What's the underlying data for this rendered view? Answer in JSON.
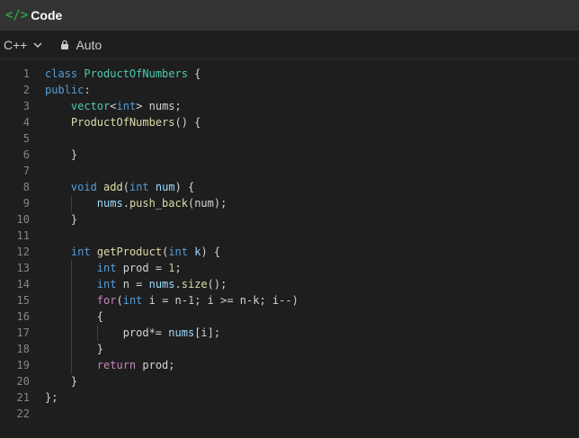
{
  "header": {
    "icon": "code-icon",
    "title": "Code"
  },
  "toolbar": {
    "language": "C++",
    "mode": "Auto"
  },
  "colors": {
    "accent": "#2ea043",
    "background": "#1e1e1e",
    "header": "#333333"
  },
  "editor": {
    "lines": [
      {
        "n": "1",
        "indent": 0,
        "tokens": [
          [
            "kw",
            "class"
          ],
          [
            "pl",
            " "
          ],
          [
            "ty",
            "ProductOfNumbers"
          ],
          [
            "pl",
            " {"
          ]
        ]
      },
      {
        "n": "2",
        "indent": 0,
        "tokens": [
          [
            "kw",
            "public"
          ],
          [
            "pl",
            ":"
          ]
        ]
      },
      {
        "n": "3",
        "indent": 1,
        "tokens": [
          [
            "ty",
            "vector"
          ],
          [
            "pl",
            "<"
          ],
          [
            "kw",
            "int"
          ],
          [
            "pl",
            "> nums;"
          ]
        ]
      },
      {
        "n": "4",
        "indent": 1,
        "tokens": [
          [
            "fn",
            "ProductOfNumbers"
          ],
          [
            "pl",
            "() {"
          ]
        ]
      },
      {
        "n": "5",
        "indent": 1,
        "tokens": []
      },
      {
        "n": "6",
        "indent": 1,
        "tokens": [
          [
            "pl",
            "}"
          ]
        ]
      },
      {
        "n": "7",
        "indent": 1,
        "tokens": []
      },
      {
        "n": "8",
        "indent": 1,
        "tokens": [
          [
            "kw",
            "void"
          ],
          [
            "pl",
            " "
          ],
          [
            "fn",
            "add"
          ],
          [
            "pl",
            "("
          ],
          [
            "kw",
            "int"
          ],
          [
            "pl",
            " "
          ],
          [
            "var",
            "num"
          ],
          [
            "pl",
            ") {"
          ]
        ]
      },
      {
        "n": "9",
        "indent": 2,
        "tokens": [
          [
            "var",
            "nums"
          ],
          [
            "pl",
            "."
          ],
          [
            "fn",
            "push_back"
          ],
          [
            "pl",
            "(num);"
          ]
        ]
      },
      {
        "n": "10",
        "indent": 1,
        "tokens": [
          [
            "pl",
            "}"
          ]
        ]
      },
      {
        "n": "11",
        "indent": 1,
        "tokens": []
      },
      {
        "n": "12",
        "indent": 1,
        "tokens": [
          [
            "kw",
            "int"
          ],
          [
            "pl",
            " "
          ],
          [
            "fn",
            "getProduct"
          ],
          [
            "pl",
            "("
          ],
          [
            "kw",
            "int"
          ],
          [
            "pl",
            " "
          ],
          [
            "var",
            "k"
          ],
          [
            "pl",
            ") {"
          ]
        ]
      },
      {
        "n": "13",
        "indent": 2,
        "tokens": [
          [
            "kw",
            "int"
          ],
          [
            "pl",
            " prod = "
          ],
          [
            "num",
            "1"
          ],
          [
            "pl",
            ";"
          ]
        ]
      },
      {
        "n": "14",
        "indent": 2,
        "tokens": [
          [
            "kw",
            "int"
          ],
          [
            "pl",
            " n = "
          ],
          [
            "var",
            "nums"
          ],
          [
            "pl",
            "."
          ],
          [
            "fn",
            "size"
          ],
          [
            "pl",
            "();"
          ]
        ]
      },
      {
        "n": "15",
        "indent": 2,
        "tokens": [
          [
            "ctrl",
            "for"
          ],
          [
            "pl",
            "("
          ],
          [
            "kw",
            "int"
          ],
          [
            "pl",
            " i = n-"
          ],
          [
            "num",
            "1"
          ],
          [
            "pl",
            "; i >= n-k; i--)"
          ]
        ]
      },
      {
        "n": "16",
        "indent": 2,
        "tokens": [
          [
            "pl",
            "{"
          ]
        ]
      },
      {
        "n": "17",
        "indent": 3,
        "tokens": [
          [
            "pl",
            "prod*= "
          ],
          [
            "var",
            "nums"
          ],
          [
            "pl",
            "[i];"
          ]
        ]
      },
      {
        "n": "18",
        "indent": 2,
        "tokens": [
          [
            "pl",
            "}"
          ]
        ]
      },
      {
        "n": "19",
        "indent": 2,
        "tokens": [
          [
            "ctrl",
            "return"
          ],
          [
            "pl",
            " prod;"
          ]
        ]
      },
      {
        "n": "20",
        "indent": 1,
        "tokens": [
          [
            "pl",
            "}"
          ]
        ]
      },
      {
        "n": "21",
        "indent": 0,
        "tokens": [
          [
            "pl",
            "};"
          ]
        ]
      },
      {
        "n": "22",
        "indent": 0,
        "tokens": []
      }
    ]
  }
}
